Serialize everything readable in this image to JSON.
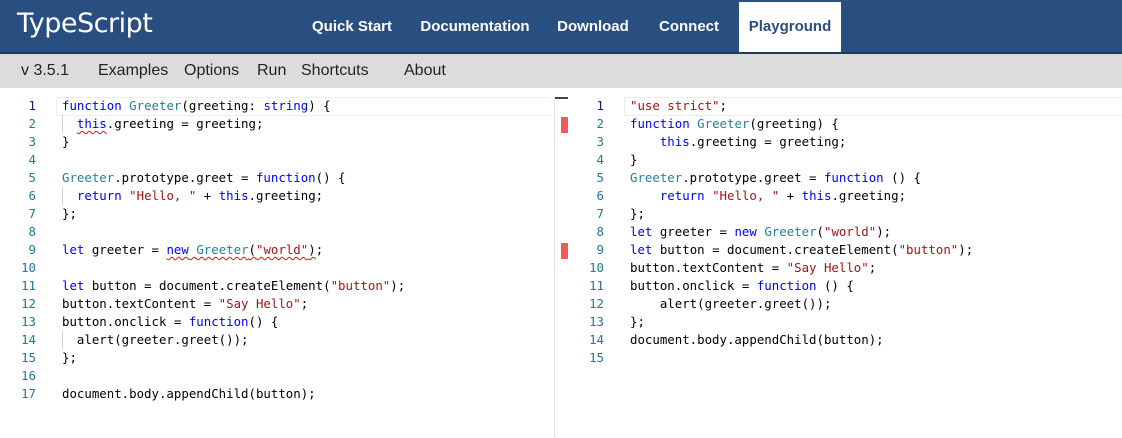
{
  "header": {
    "logo": "TypeScript",
    "nav": [
      {
        "label": "Quick Start"
      },
      {
        "label": "Documentation"
      },
      {
        "label": "Download"
      },
      {
        "label": "Connect"
      },
      {
        "label": "Playground"
      }
    ],
    "active": "Playground"
  },
  "toolbar": {
    "version": "v 3.5.1",
    "items": [
      {
        "label": "Examples"
      },
      {
        "label": "Options"
      },
      {
        "label": "Run"
      },
      {
        "label": "Shortcuts"
      },
      {
        "label": "About"
      }
    ]
  },
  "ts_editor": {
    "lines": [
      {
        "n": "1",
        "tokens": [
          [
            "kw",
            "function"
          ],
          [
            "",
            " "
          ],
          [
            "ty",
            "Greeter"
          ],
          [
            "",
            "(greeting: "
          ],
          [
            "kw",
            "string"
          ],
          [
            "",
            ") {"
          ]
        ]
      },
      {
        "n": "2",
        "tokens": [
          [
            "",
            "  "
          ],
          [
            "kw squig",
            "this"
          ],
          [
            "",
            ".greeting = greeting;"
          ]
        ]
      },
      {
        "n": "3",
        "tokens": [
          [
            "",
            "}"
          ]
        ]
      },
      {
        "n": "4",
        "tokens": []
      },
      {
        "n": "5",
        "tokens": [
          [
            "ty",
            "Greeter"
          ],
          [
            "",
            ".prototype.greet = "
          ],
          [
            "kw",
            "function"
          ],
          [
            "",
            "() {"
          ]
        ]
      },
      {
        "n": "6",
        "tokens": [
          [
            "",
            "  "
          ],
          [
            "kw",
            "return"
          ],
          [
            "",
            " "
          ],
          [
            "str",
            "\"Hello, \""
          ],
          [
            "",
            ""
          ],
          [
            "",
            " + "
          ],
          [
            "kw",
            "this"
          ],
          [
            "",
            ".greeting;"
          ]
        ]
      },
      {
        "n": "7",
        "tokens": [
          [
            "",
            "};"
          ]
        ]
      },
      {
        "n": "8",
        "tokens": []
      },
      {
        "n": "9",
        "tokens": [
          [
            "kw",
            "let"
          ],
          [
            "",
            " greeter = "
          ],
          [
            "kw squig",
            "new"
          ],
          [
            "squig",
            " "
          ],
          [
            "ty squig",
            "Greeter"
          ],
          [
            "squig",
            "("
          ],
          [
            "str squig",
            "\"world\""
          ],
          [
            "squig",
            ")"
          ],
          [
            "",
            ";"
          ]
        ]
      },
      {
        "n": "10",
        "tokens": []
      },
      {
        "n": "11",
        "tokens": [
          [
            "kw",
            "let"
          ],
          [
            "",
            ""
          ],
          [
            "",
            ""
          ],
          [
            "",
            ""
          ],
          [
            "",
            ""
          ],
          [
            "",
            ""
          ],
          [
            "",
            ""
          ],
          [
            "",
            ""
          ],
          [
            "",
            ""
          ],
          [
            "",
            ""
          ],
          [
            "",
            ""
          ],
          [
            "",
            ""
          ],
          [
            "",
            ""
          ],
          [
            "",
            ""
          ],
          [
            "",
            ""
          ],
          [
            "",
            ""
          ],
          [
            "",
            ""
          ],
          [
            "",
            ""
          ],
          [
            "",
            " button = document.createElement("
          ],
          [
            "str",
            "\"button\""
          ],
          [
            "",
            ");"
          ]
        ]
      },
      {
        "n": "12",
        "tokens": [
          [
            "",
            "button.textContent = "
          ],
          [
            "str",
            "\"Say Hello\""
          ],
          [
            "",
            ";"
          ]
        ]
      },
      {
        "n": "13",
        "tokens": [
          [
            "",
            "button.onclick = "
          ],
          [
            "kw",
            "function"
          ],
          [
            "",
            "() {"
          ]
        ]
      },
      {
        "n": "14",
        "tokens": [
          [
            "",
            "  alert(greeter.greet());"
          ]
        ]
      },
      {
        "n": "15",
        "tokens": [
          [
            "",
            "};"
          ]
        ]
      },
      {
        "n": "16",
        "tokens": []
      },
      {
        "n": "17",
        "tokens": [
          [
            "",
            "document.body.appendChild(button);"
          ]
        ]
      }
    ]
  },
  "js_output": {
    "lines": [
      {
        "n": "1",
        "tokens": [
          [
            "str",
            "\"use strict\""
          ],
          [
            "",
            ";"
          ]
        ]
      },
      {
        "n": "2",
        "tokens": [
          [
            "kw",
            "function"
          ],
          [
            "",
            " "
          ],
          [
            "ty",
            "Greeter"
          ],
          [
            "",
            "(greeting) {"
          ]
        ]
      },
      {
        "n": "3",
        "tokens": [
          [
            "",
            "    "
          ],
          [
            "kw",
            "this"
          ],
          [
            "",
            ".greeting = greeting;"
          ]
        ]
      },
      {
        "n": "4",
        "tokens": [
          [
            "",
            "}"
          ]
        ]
      },
      {
        "n": "5",
        "tokens": [
          [
            "ty",
            "Greeter"
          ],
          [
            "",
            ".prototype.greet = "
          ],
          [
            "kw",
            "function"
          ],
          [
            "",
            " () {"
          ]
        ]
      },
      {
        "n": "6",
        "tokens": [
          [
            "",
            "    "
          ],
          [
            "kw",
            "return"
          ],
          [
            "",
            " "
          ],
          [
            "str",
            "\"Hello, \""
          ],
          [
            "",
            " + "
          ],
          [
            "kw",
            "this"
          ],
          [
            "",
            ".greeting;"
          ]
        ]
      },
      {
        "n": "7",
        "tokens": [
          [
            "",
            "};"
          ]
        ]
      },
      {
        "n": "8",
        "tokens": [
          [
            "kw",
            "let"
          ],
          [
            "",
            ""
          ],
          [
            "",
            " greeter = "
          ],
          [
            "kw",
            "new"
          ],
          [
            "",
            " "
          ],
          [
            "ty",
            "Greeter"
          ],
          [
            "",
            "("
          ],
          [
            "str",
            "\"world\""
          ],
          [
            "",
            ");"
          ]
        ]
      },
      {
        "n": "9",
        "tokens": [
          [
            "kw",
            "let"
          ],
          [
            "",
            " button = document.createElement("
          ],
          [
            "str",
            "\"button\""
          ],
          [
            "",
            ");"
          ]
        ]
      },
      {
        "n": "10",
        "tokens": [
          [
            "",
            "button.textContent = "
          ],
          [
            "str",
            "\"Say Hello\""
          ],
          [
            "",
            ";"
          ]
        ]
      },
      {
        "n": "11",
        "tokens": [
          [
            "",
            "button.onclick = "
          ],
          [
            "kw",
            "function"
          ],
          [
            "",
            " () {"
          ]
        ]
      },
      {
        "n": "12",
        "tokens": [
          [
            "",
            "    alert(greeter.greet());"
          ]
        ]
      },
      {
        "n": "13",
        "tokens": [
          [
            "",
            "};"
          ]
        ]
      },
      {
        "n": "14",
        "tokens": [
          [
            "",
            "document.body.appendChild(button);"
          ]
        ]
      },
      {
        "n": "15",
        "tokens": []
      }
    ]
  },
  "colors": {
    "header_bg": "#294e80",
    "toolbar_bg": "#dcdcdc",
    "keyword": "#0000ff",
    "type": "#267f99",
    "string": "#a31515",
    "line_number": "#237893",
    "error_mark": "#f05a5a"
  }
}
